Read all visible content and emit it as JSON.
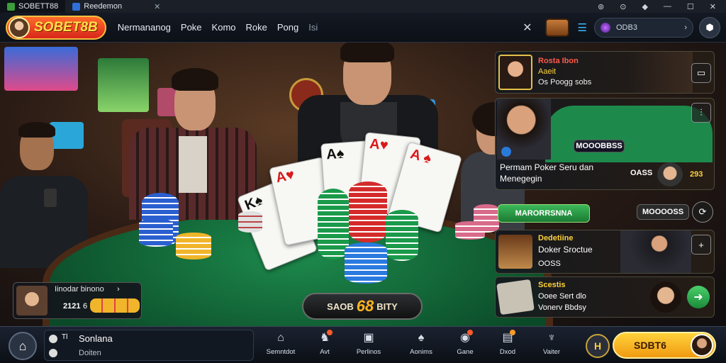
{
  "titlebar": {
    "tabs": [
      {
        "label": "SOBETT88"
      },
      {
        "label": "Reedemon"
      }
    ],
    "close_tab": "✕",
    "controls": [
      "⊚",
      "⊙",
      "◆",
      "—",
      "☐",
      "✕"
    ]
  },
  "header": {
    "logo_text": "SOBET8B",
    "nav": [
      "Nermananog",
      "Poke",
      "Komo",
      "Roke",
      "Pong",
      "Isi"
    ],
    "close": "✕",
    "search_value": "ODB3",
    "search_chevron": "›"
  },
  "panels": {
    "p1": {
      "title": "Rosta Ibon",
      "sub": "Aaeit",
      "line": "Os Poogg sobs"
    },
    "p2": {
      "badge": "MOOOBBSS",
      "title": "Permam Poker Seru dan",
      "title2": "Menegegin",
      "count": "OASS",
      "small": "293"
    },
    "p3": {
      "label": "MARORRSNNA",
      "side": "MOOOOSS"
    },
    "p4": {
      "title": "Dedetiine",
      "sub": "Doker Sroctue",
      "value": "OOSS"
    },
    "p5": {
      "title": "Scestis",
      "line1": "Ooee Sert dlo",
      "line2": "Vonerv Bbdsy"
    }
  },
  "player": {
    "name": "Iinodar binono",
    "chevron": "›",
    "amount": "2121",
    "suffix": "6"
  },
  "bet_button": {
    "pre": "SAOB",
    "num": "68",
    "post": "BITY"
  },
  "bottom": {
    "user_name": "Sonlana",
    "user_sub": "Doiten",
    "user_tag": "Tl",
    "nav": [
      {
        "label": "Semntdot",
        "icon": "⌂"
      },
      {
        "label": "Avt",
        "icon": "♞"
      },
      {
        "label": "Perlinos",
        "icon": "▣"
      },
      {
        "label": "Aonims",
        "icon": "♠"
      },
      {
        "label": "Gane",
        "icon": "◉"
      },
      {
        "label": "Dxod",
        "icon": "▤"
      },
      {
        "label": "Vaiter",
        "icon": "♆"
      }
    ],
    "cta": "SDBT6"
  },
  "colors": {
    "accent": "#ffd23a",
    "table": "#1d8a4c",
    "brand": "#d8261b"
  }
}
